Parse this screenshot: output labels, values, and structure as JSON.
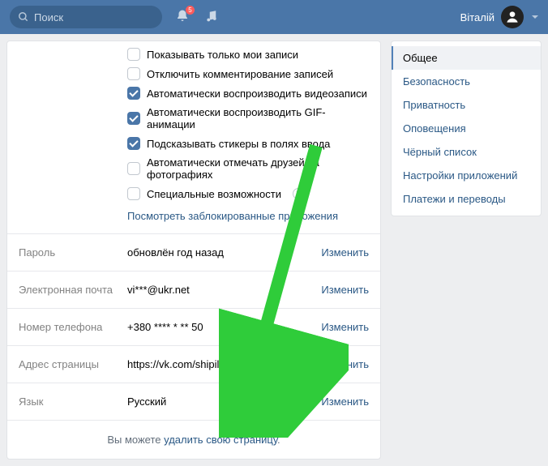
{
  "header": {
    "search_placeholder": "Поиск",
    "notification_count": "5",
    "username": "Віталій"
  },
  "checkboxes": [
    {
      "checked": false,
      "label": "Показывать только мои записи"
    },
    {
      "checked": false,
      "label": "Отключить комментирование записей"
    },
    {
      "checked": true,
      "label": "Автоматически воспроизводить видеозаписи"
    },
    {
      "checked": true,
      "label": "Автоматически воспроизводить GIF-анимации"
    },
    {
      "checked": true,
      "label": "Подсказывать стикеры в полях ввода"
    },
    {
      "checked": false,
      "label": "Автоматически отмечать друзей на фотографиях"
    },
    {
      "checked": false,
      "label": "Специальные возможности",
      "help": true
    }
  ],
  "blocked_apps_link": "Посмотреть заблокированные приложения",
  "change_label": "Изменить",
  "rows": [
    {
      "label": "Пароль",
      "value": "обновлён год назад"
    },
    {
      "label": "Электронная почта",
      "value": "vi***@ukr.net"
    },
    {
      "label": "Номер телефона",
      "value": "+380 **** * ** 50"
    },
    {
      "label": "Адрес страницы",
      "value": "https://vk.com/shipiloff_vitalik"
    },
    {
      "label": "Язык",
      "value": "Русский"
    }
  ],
  "footer": {
    "prefix": "Вы можете ",
    "link": "удалить свою страницу",
    "suffix": "."
  },
  "sidebar": [
    {
      "label": "Общее",
      "active": true
    },
    {
      "label": "Безопасность"
    },
    {
      "label": "Приватность"
    },
    {
      "label": "Оповещения"
    },
    {
      "label": "Чёрный список"
    },
    {
      "label": "Настройки приложений"
    },
    {
      "label": "Платежи и переводы"
    }
  ]
}
